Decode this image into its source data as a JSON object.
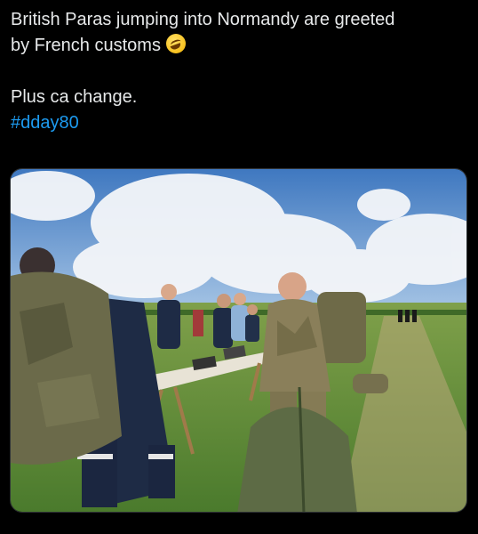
{
  "post": {
    "line1": "British Paras jumping into Normandy are greeted",
    "line2": "by French customs",
    "line3": "Plus ca change.",
    "hashtag": "#dday80",
    "emoji_icon": "rolling-on-the-floor-laughing-emoji"
  },
  "media": {
    "icon": "photo",
    "colors": {
      "sky": "#4f86c6",
      "grass": "#5f8f3a",
      "uniform": "#1e2b45",
      "camo": "#6e6a48"
    }
  }
}
